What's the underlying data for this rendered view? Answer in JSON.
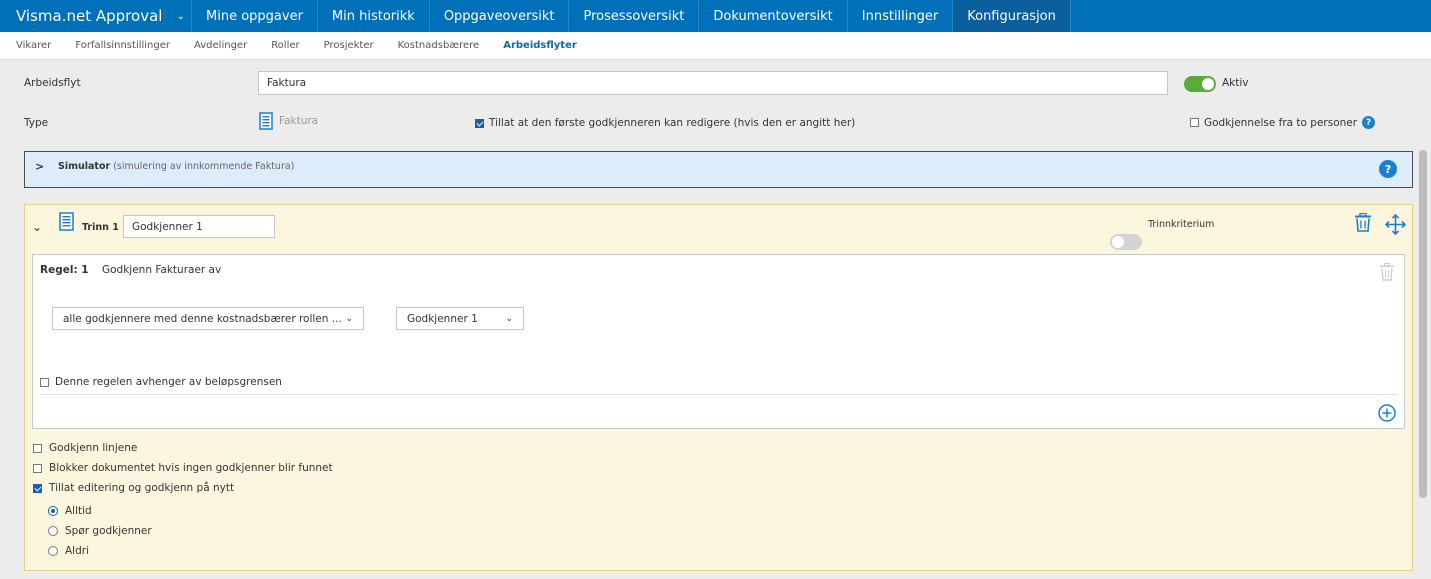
{
  "app": {
    "title": "Visma.net Approval"
  },
  "nav": {
    "items": [
      {
        "label": "Mine oppgaver",
        "active": false
      },
      {
        "label": "Min historikk",
        "active": false
      },
      {
        "label": "Oppgaveoversikt",
        "active": false
      },
      {
        "label": "Prosessoversikt",
        "active": false
      },
      {
        "label": "Dokumentoversikt",
        "active": false
      },
      {
        "label": "Innstillinger",
        "active": false
      },
      {
        "label": "Konfigurasjon",
        "active": true
      }
    ]
  },
  "subnav": {
    "items": [
      {
        "label": "Vikarer",
        "active": false
      },
      {
        "label": "Forfallsinnstillinger",
        "active": false
      },
      {
        "label": "Avdelinger",
        "active": false
      },
      {
        "label": "Roller",
        "active": false
      },
      {
        "label": "Prosjekter",
        "active": false
      },
      {
        "label": "Kostnadsbærere",
        "active": false
      },
      {
        "label": "Arbeidsflyter",
        "active": true
      }
    ]
  },
  "form": {
    "workflow_label": "Arbeidsflyt",
    "workflow_value": "Faktura",
    "active_label": "Aktiv",
    "active_on": true,
    "type_label": "Type",
    "type_value": "Faktura",
    "allow_first_edit_label": "Tillat at den første godkjenneren kan redigere (hvis den er angitt her)",
    "allow_first_edit_checked": true,
    "two_person_label": "Godkjennelse fra to personer",
    "two_person_checked": false,
    "help_glyph": "?"
  },
  "simulator": {
    "title": "Simulator",
    "subtitle": "(simulering av innkommende Faktura)",
    "chevron": ">"
  },
  "step": {
    "label": "Trinn 1 :",
    "name_value": "Godkjenner 1",
    "criterion_label": "Trinnkriterium",
    "criterion_on": false,
    "rule": {
      "label": "Regel: 1",
      "description": "Godkjenn Fakturaer av",
      "approver_select": "alle godkjennere med denne kostnadsbærer rollen ...",
      "role_select": "Godkjenner 1",
      "amount_limit_label": "Denne regelen avhenger av beløpsgrensen",
      "amount_limit_checked": false
    },
    "options": [
      {
        "label": "Godkjenn linjene",
        "checked": false
      },
      {
        "label": "Blokker dokumentet hvis ingen godkjenner blir funnet",
        "checked": false
      },
      {
        "label": "Tillat editering og godkjenn på nytt",
        "checked": true
      }
    ],
    "reapprove_options": [
      {
        "label": "Alltid",
        "selected": true
      },
      {
        "label": "Spør godkjenner",
        "selected": false
      },
      {
        "label": "Aldri",
        "selected": false
      }
    ]
  },
  "colors": {
    "brand": "#0070b8",
    "accent": "#1a7fd0",
    "toggle_on": "#5aab3c",
    "step_bg": "#fdf6df",
    "simulator_bg": "#ddecfb"
  }
}
